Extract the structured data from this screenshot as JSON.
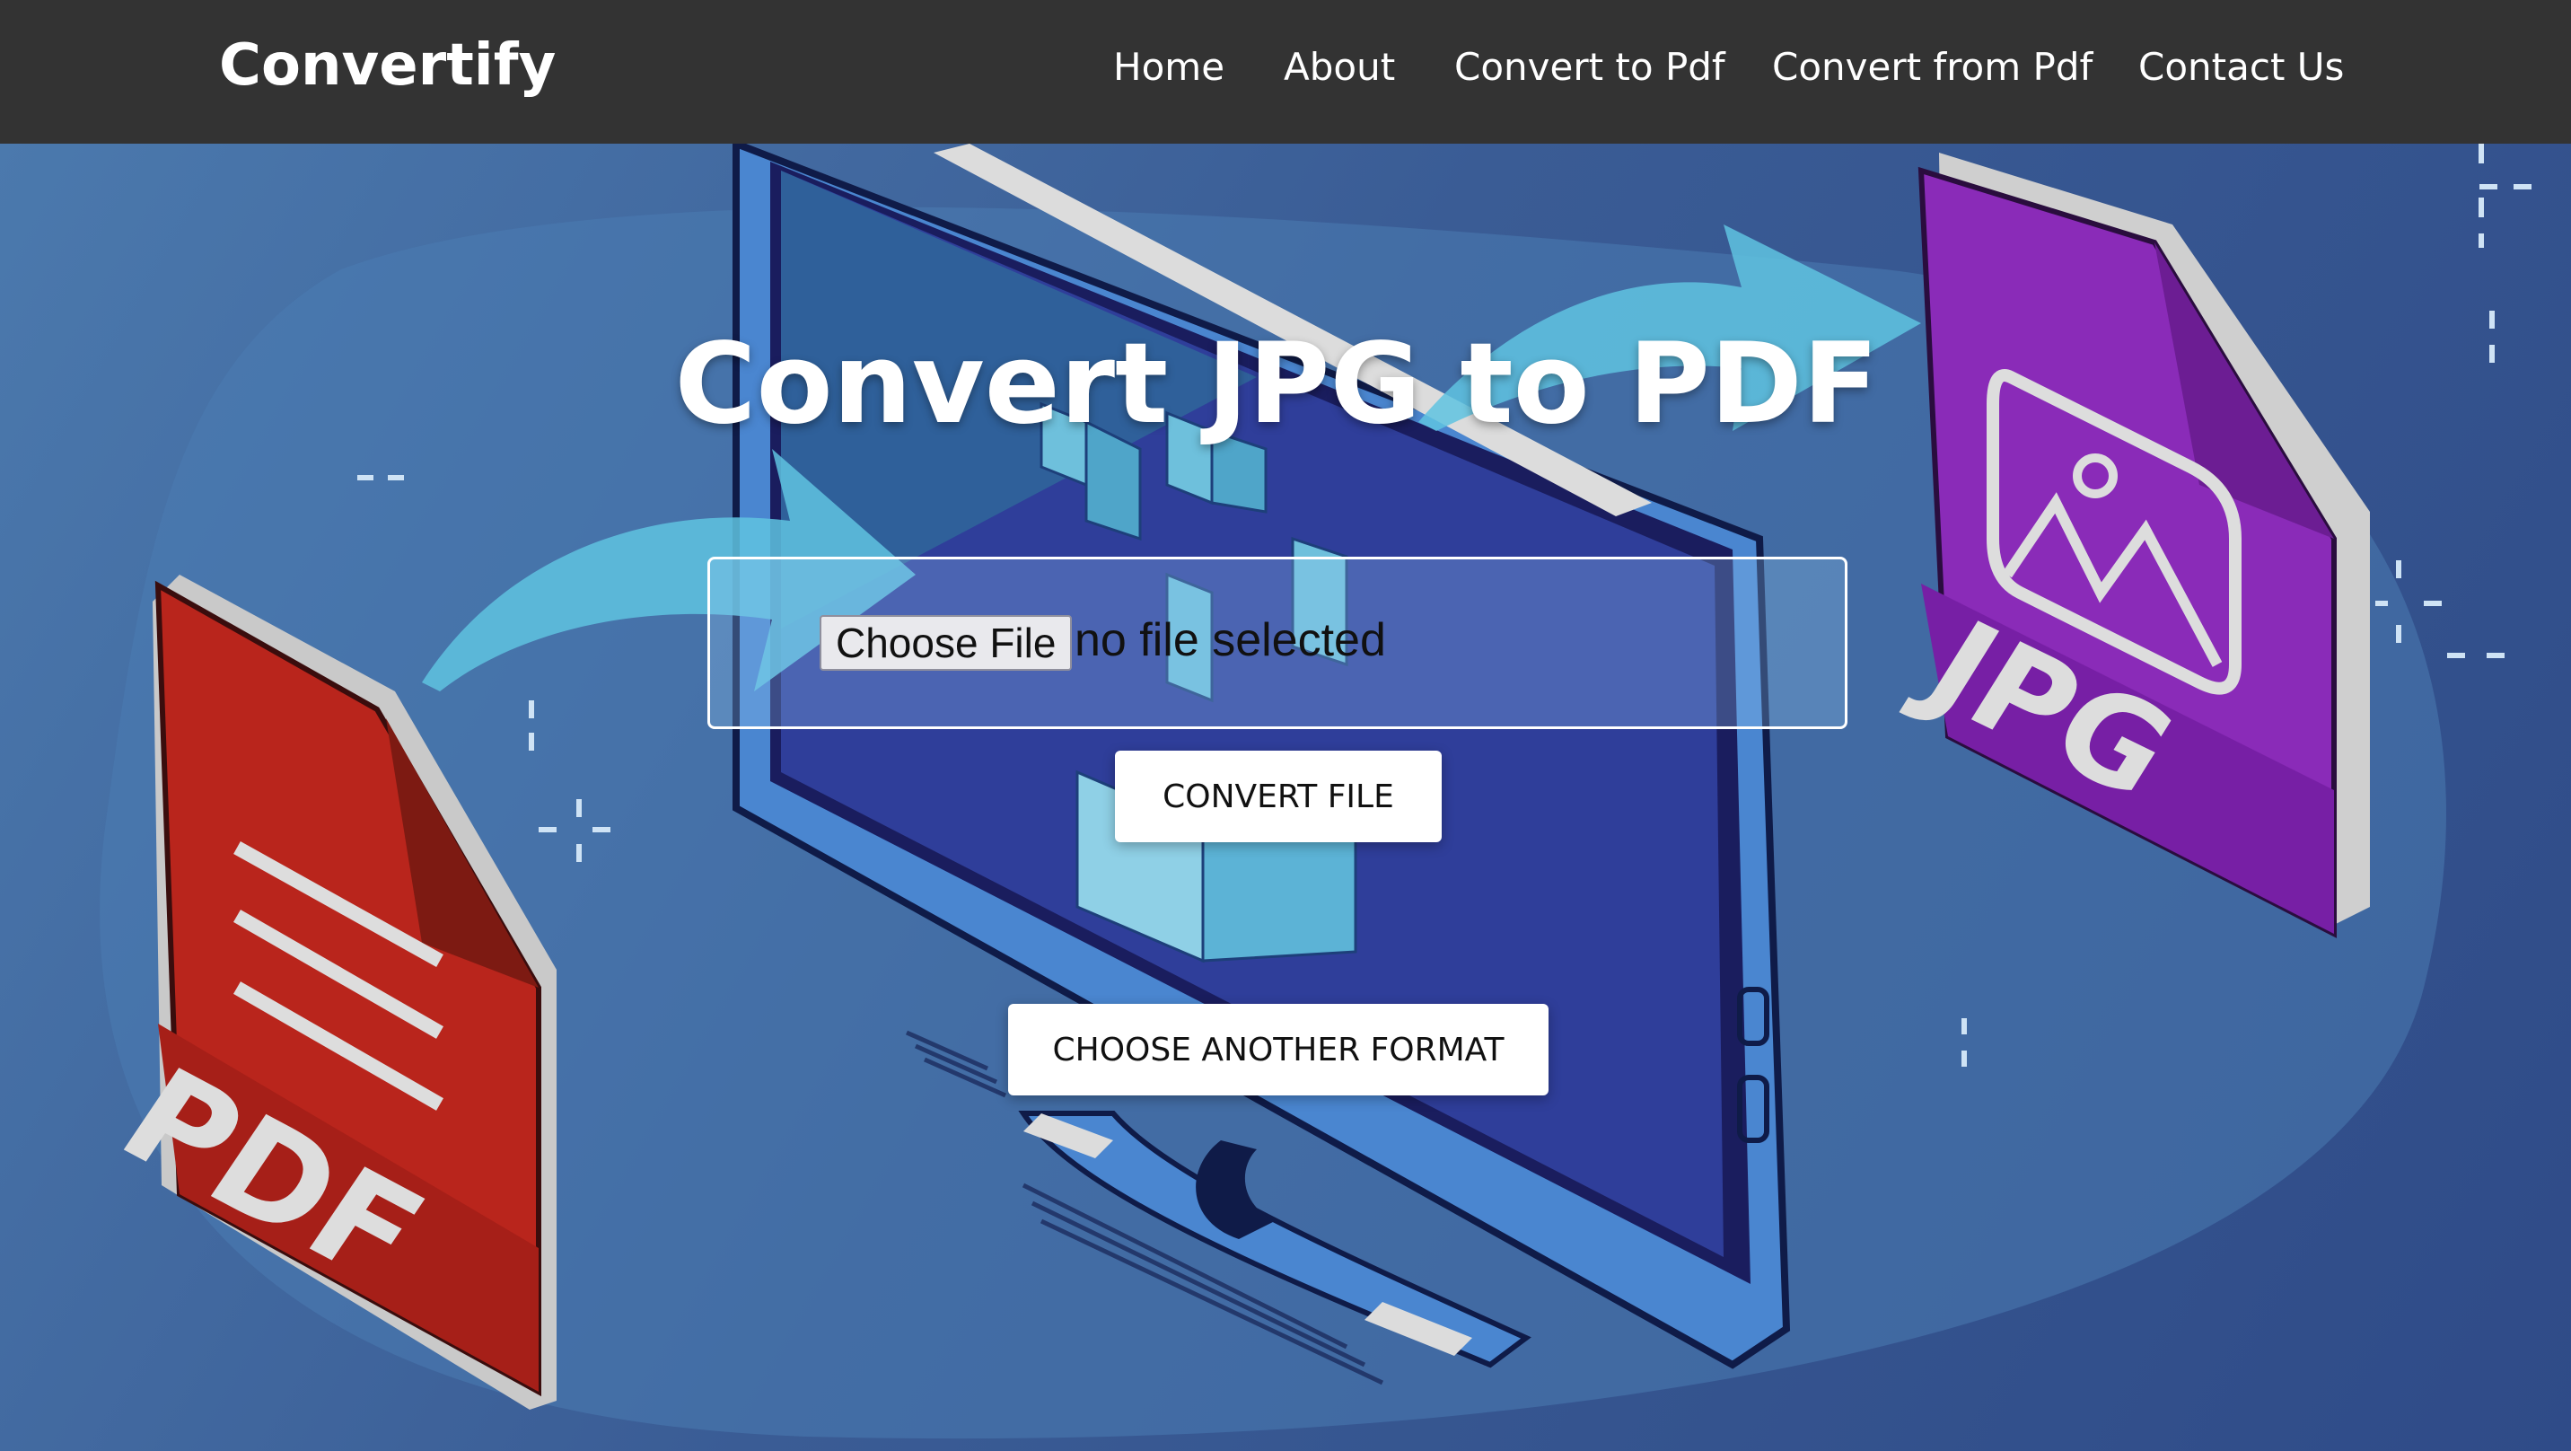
{
  "navbar": {
    "brand": "Convertify",
    "links": [
      {
        "label": "Home"
      },
      {
        "label": "About"
      },
      {
        "label": "Convert to Pdf"
      },
      {
        "label": "Convert from Pdf"
      },
      {
        "label": "Contact Us"
      }
    ],
    "background": "#333333"
  },
  "hero": {
    "title": "Convert JPG to PDF",
    "file_input": {
      "button_label": "Choose File",
      "status": "no file selected"
    },
    "convert_button": "CONVERT FILE",
    "format_button": "CHOOSE ANOTHER FORMAT",
    "illustration": {
      "left_doc_label": "PDF",
      "right_doc_label": "JPG",
      "left_doc_color": "#c0281e",
      "right_doc_color": "#8a2bb8",
      "monitor_color": "#4a86d0",
      "arrow_color": "#5fc3e0"
    }
  }
}
